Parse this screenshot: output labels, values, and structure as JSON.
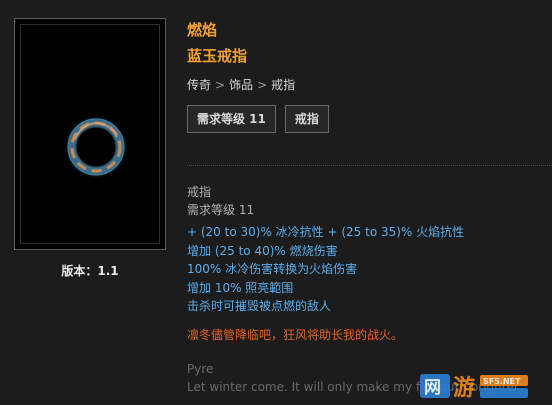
{
  "item": {
    "name": "燃焰",
    "base_name": "蓝玉戒指",
    "breadcrumb": [
      "传奇",
      "饰品",
      "戒指"
    ],
    "breadcrumb_sep": ">",
    "tags": [
      "需求等级 11",
      "戒指"
    ],
    "version": "版本：1.1"
  },
  "details": {
    "type": "戒指",
    "requirement": "需求等级 11",
    "mods": [
      " + (20 to 30)% 冰冷抗性 + (25 to 35)% 火焰抗性",
      "增加 (25 to 40)% 燃烧伤害",
      "100% 冰冷伤害转换为火焰伤害",
      "增加 10% 照亮範围",
      "击杀时可摧毁被点燃的敌人"
    ],
    "lore": "凛冬儘管降临吧，狂风将助长我的战火。",
    "flavor_title": "Pyre",
    "flavor_text": "Let winter come. It will only make my fire burn brighter."
  },
  "watermark": {
    "logo_text": "游",
    "site": "SF5.NET"
  },
  "colors": {
    "unique": "#f0a030",
    "magic": "#5aaeee",
    "lore": "#e0612a",
    "flavor": "#6a6a6a"
  }
}
